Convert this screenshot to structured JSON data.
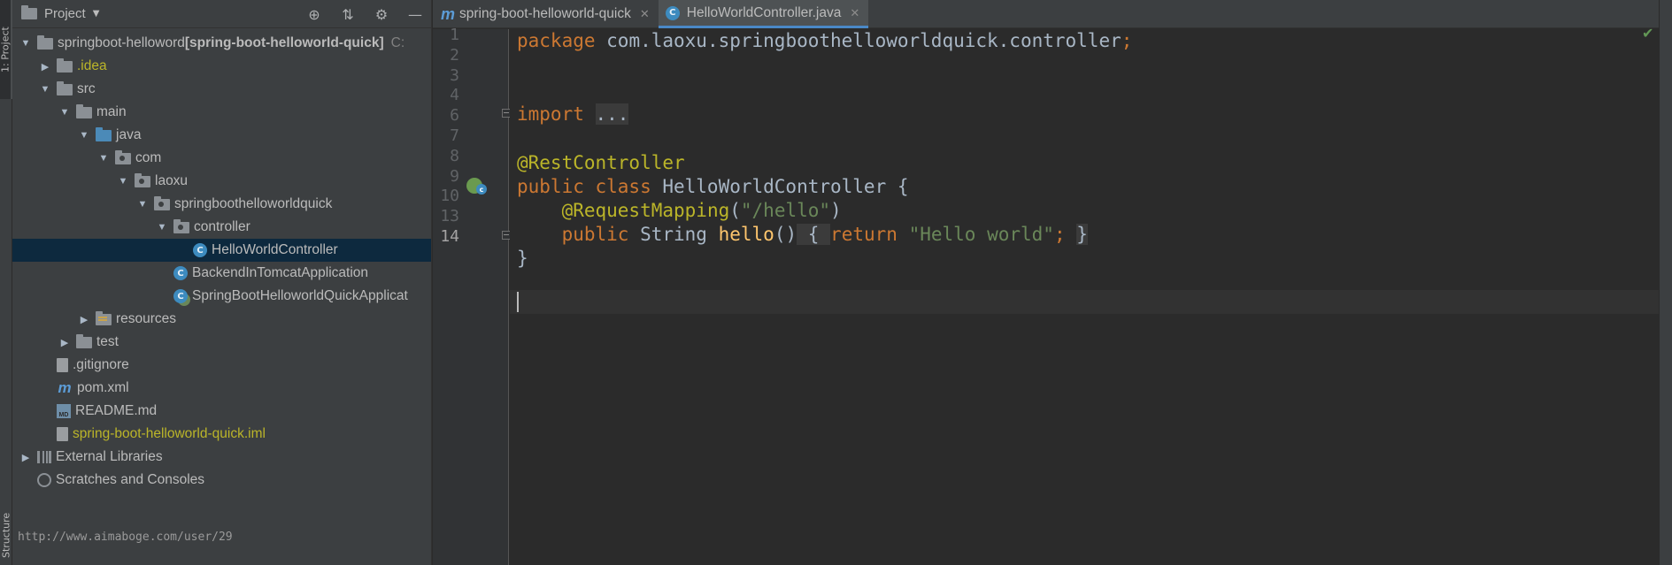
{
  "left_strip": {
    "top_tab": "1: Project",
    "bottom_tab": "Structure"
  },
  "project_panel": {
    "title": "Project",
    "tree": [
      {
        "label": "springboot-helloword",
        "suffix": " [spring-boot-helloworld-quick]",
        "extra": "C:",
        "icon": "module-folder-icon",
        "arrow": "down"
      },
      {
        "label": ".idea",
        "icon": "folder-icon",
        "arrow": "right",
        "color": "yellow"
      },
      {
        "label": "src",
        "icon": "folder-icon",
        "arrow": "down"
      },
      {
        "label": "main",
        "icon": "folder-icon",
        "arrow": "down"
      },
      {
        "label": "java",
        "icon": "source-folder-icon",
        "arrow": "down"
      },
      {
        "label": "com",
        "icon": "package-icon",
        "arrow": "down"
      },
      {
        "label": "laoxu",
        "icon": "package-icon",
        "arrow": "down"
      },
      {
        "label": "springboothelloworldquick",
        "icon": "package-icon",
        "arrow": "down"
      },
      {
        "label": "controller",
        "icon": "package-icon",
        "arrow": "down"
      },
      {
        "label": "HelloWorldController",
        "icon": "class-icon",
        "arrow": "",
        "selected": true
      },
      {
        "label": "BackendInTomcatApplication",
        "icon": "class-icon",
        "arrow": ""
      },
      {
        "label": "SpringBootHelloworldQuickApplicat",
        "icon": "spring-boot-class-icon",
        "arrow": ""
      },
      {
        "label": "resources",
        "icon": "resources-folder-icon",
        "arrow": "right"
      },
      {
        "label": "test",
        "icon": "folder-icon",
        "arrow": "right"
      },
      {
        "label": ".gitignore",
        "icon": "file-icon",
        "arrow": ""
      },
      {
        "label": "pom.xml",
        "icon": "maven-icon",
        "arrow": ""
      },
      {
        "label": "README.md",
        "icon": "markdown-icon",
        "arrow": ""
      },
      {
        "label": "spring-boot-helloworld-quick.iml",
        "icon": "file-icon",
        "arrow": "",
        "color": "yellow"
      },
      {
        "label": "External Libraries",
        "icon": "libraries-icon",
        "arrow": "right"
      },
      {
        "label": "Scratches and Consoles",
        "icon": "scratches-icon",
        "arrow": ""
      }
    ],
    "watermark": "http://www.aimaboge.com/user/29"
  },
  "tabs": [
    {
      "label": "spring-boot-helloworld-quick",
      "icon": "maven-icon",
      "active": false
    },
    {
      "label": "HelloWorldController.java",
      "icon": "class-icon",
      "active": true
    }
  ],
  "editor": {
    "line_numbers": [
      "1",
      "2",
      "3",
      "4",
      "6",
      "7",
      "8",
      "9",
      "10",
      "13",
      "14"
    ],
    "current_line": "14",
    "lines": {
      "l1_kw": "package",
      "l1_rest": " com.laoxu.springboothelloworldquick.controller",
      "l1_semi": ";",
      "l4_kw": "import",
      "l4_folded": "...",
      "l7_ann": "@RestController",
      "l8_kw": "public class",
      "l8_rest": " HelloWorldController {",
      "l9_ann": "@RequestMapping",
      "l9_open": "(",
      "l9_str": "\"/hello\"",
      "l9_close": ")",
      "l10_kw": "public",
      "l10_type": " String ",
      "l10_fn": "hello",
      "l10_parens": "()",
      "l10_brace_open": " { ",
      "l10_return": "return ",
      "l10_str": "\"Hello world\"",
      "l10_semi": "; ",
      "l10_brace_close": "}",
      "l13": "}"
    }
  },
  "colors": {
    "keyword": "#cc7832",
    "annotation": "#bbb529",
    "string": "#6a8759",
    "function": "#ffc66d",
    "text": "#a9b7c6",
    "selection": "#0d293e"
  }
}
